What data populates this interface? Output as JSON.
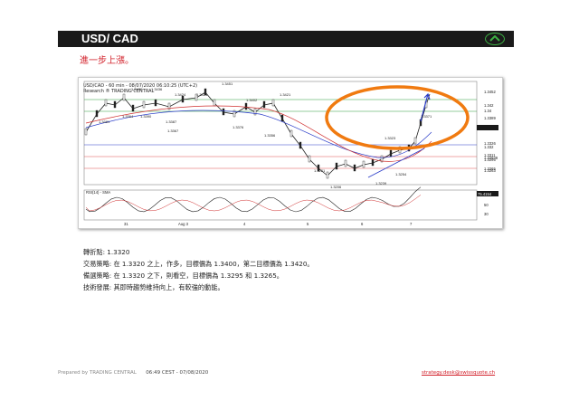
{
  "header": {
    "title": "USD/ CAD"
  },
  "subtitle": "進一步上漲。",
  "chart": {
    "title_line1": "USD/CAD - 60 min - 08/07/2020 06:10:25 (UTC+2)",
    "title_line2": "Research ® TRADING CENTRAL",
    "price_axis": [
      "1.3452",
      "1.342",
      "1.34",
      "1.3389",
      "1.33876",
      "1.3326",
      "1.332",
      "1.3311",
      "1.32948",
      "1.3295",
      "1.3265",
      "1.3263"
    ],
    "peak_labels": [
      "1.3430",
      "1.3436",
      "1.3424",
      "1.3421",
      "1.3451",
      "1.3402",
      "1.3421",
      "1.3323",
      "1.3371"
    ],
    "trough_labels": [
      "1.3381",
      "1.3394",
      "1.3390",
      "1.3387",
      "1.3367",
      "1.3376",
      "1.3356",
      "1.3221",
      "1.3206",
      "1.3239",
      "1.3254"
    ],
    "rsi_label": "RSI(14) - SMA",
    "rsi_axis": [
      "75.4154",
      "50",
      "30"
    ],
    "rsi_badge": "75.4154",
    "date_labels": [
      "31",
      "Aug 3",
      "4",
      "5",
      "6",
      "7"
    ]
  },
  "info": {
    "pivot": "轉折點: 1.3320",
    "strategy": "交易策略: 在 1.3320 之上，作多，目標價為 1.3400，第二目標價為 1.3420。",
    "alternative": "備選策略: 在 1.3320 之下，則看空，目標價為 1.3295 和 1.3265。",
    "comment": "技術發展: 其即時趨勢維持向上，有較強的動能。"
  },
  "footer": {
    "prepared": "Prepared by TRADING CENTRAL",
    "time": "06:49 CEST - 07/08/2020",
    "email": "strategy.desk@swissquote.ch"
  },
  "colors": {
    "header_bg": "#1a1a1a",
    "accent_red": "#d2202a",
    "accent_green": "#3cb043",
    "orange_ellipse": "#f07a10"
  }
}
